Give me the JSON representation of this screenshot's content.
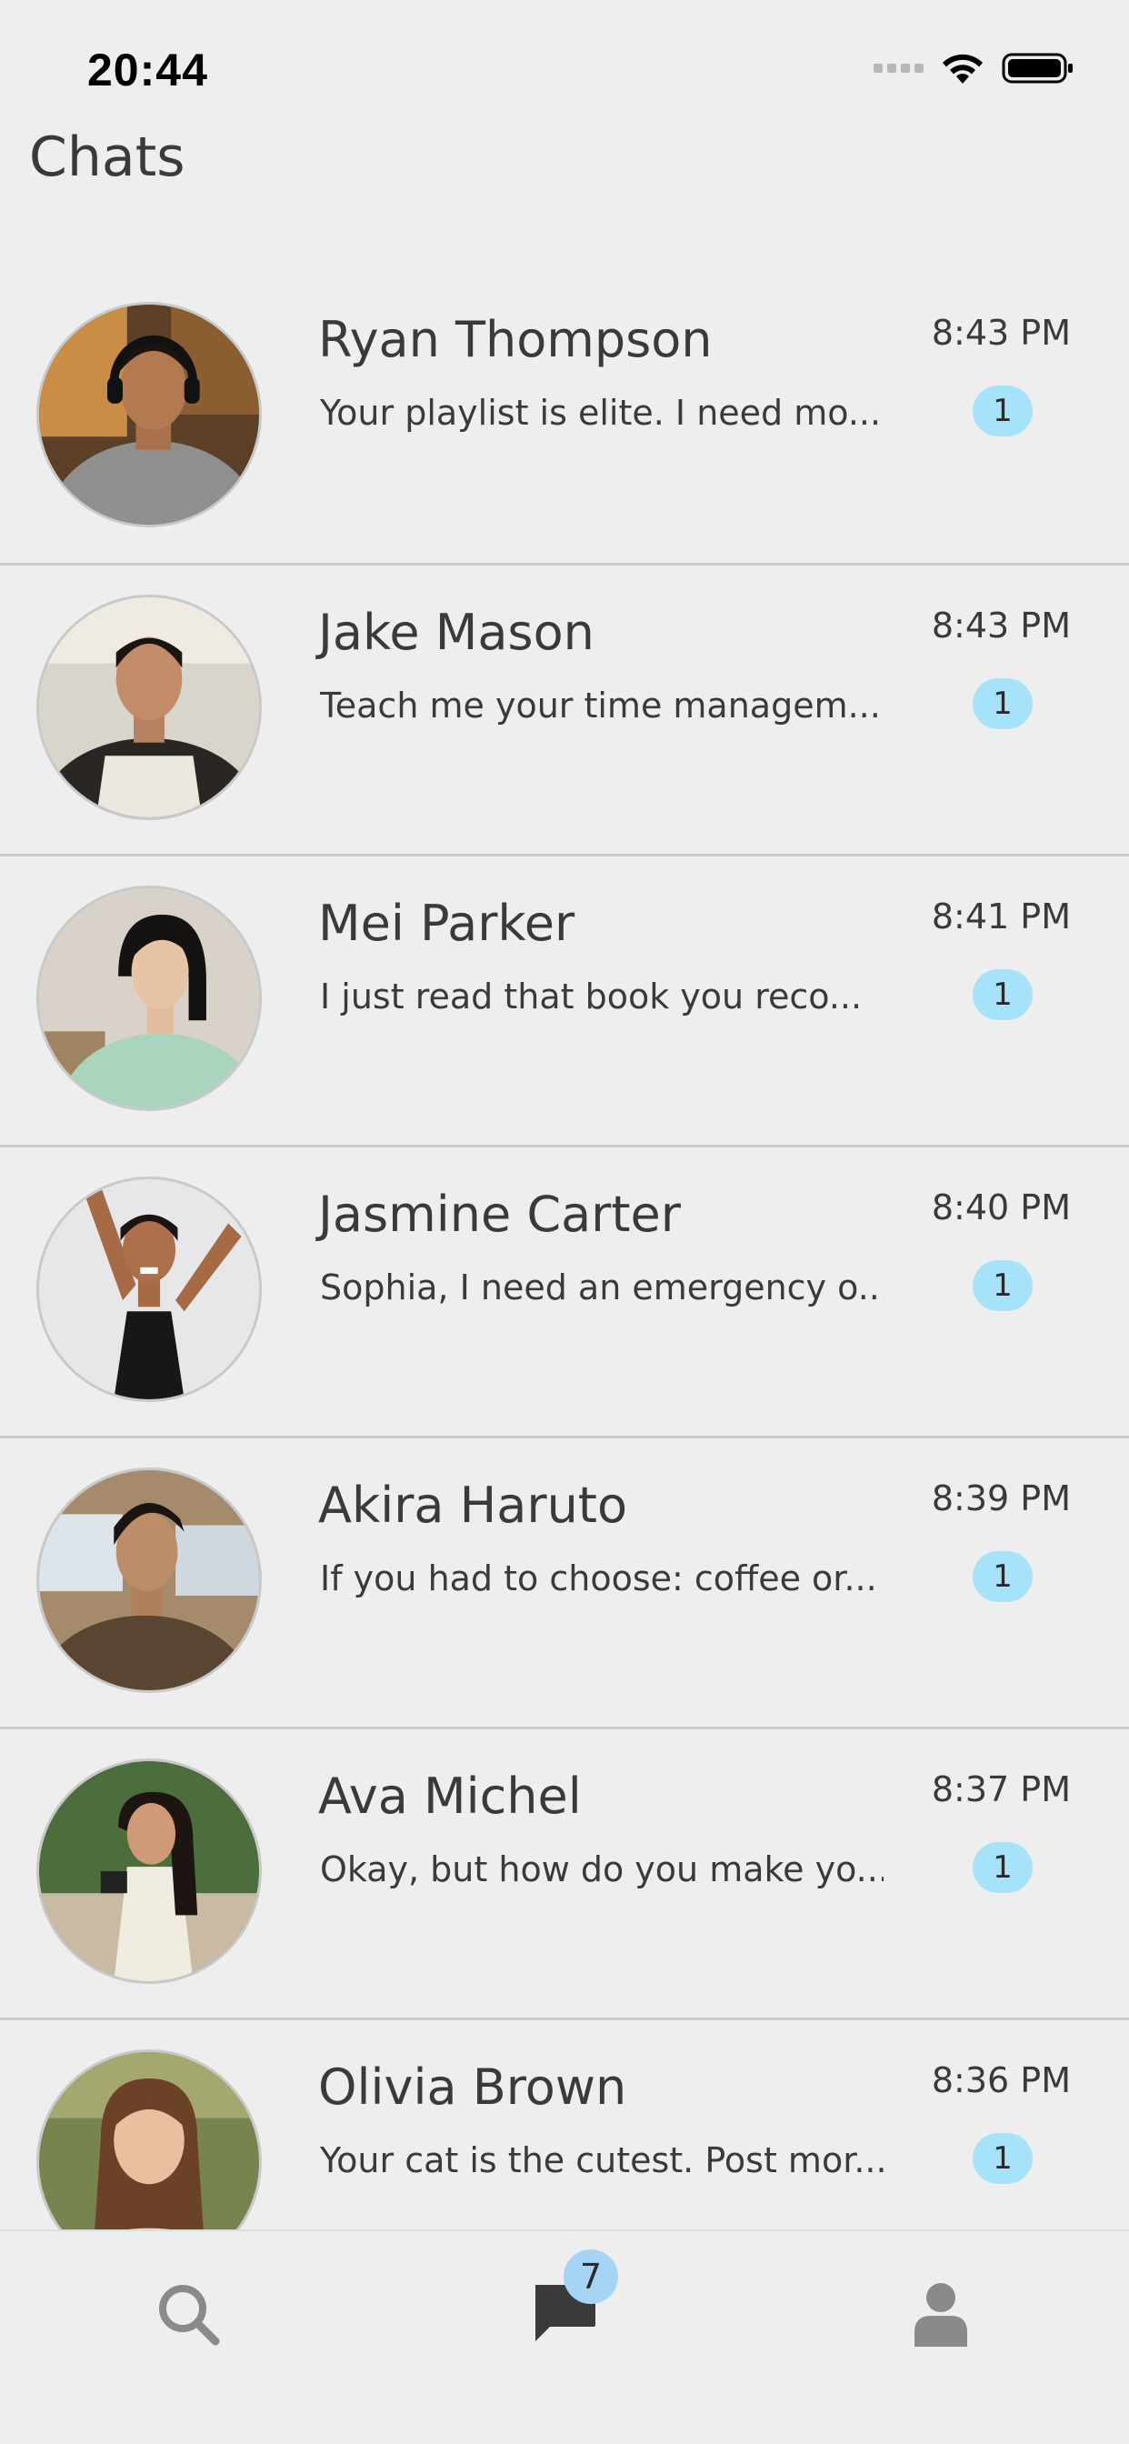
{
  "status_bar": {
    "time": "20:44"
  },
  "header": {
    "title": "Chats"
  },
  "chats": [
    {
      "name": "Ryan Thompson",
      "preview": "Your playlist is elite. I need mo...",
      "time": "8:43 PM",
      "unread": "1"
    },
    {
      "name": "Jake Mason",
      "preview": "Teach me your time managem...",
      "time": "8:43 PM",
      "unread": "1"
    },
    {
      "name": "Mei Parker",
      "preview": "I just read that book you reco...",
      "time": "8:41 PM",
      "unread": "1"
    },
    {
      "name": "Jasmine Carter",
      "preview": "Sophia, I need an emergency o...",
      "time": "8:40 PM",
      "unread": "1"
    },
    {
      "name": "Akira Haruto",
      "preview": "If you had to choose: coffee or...",
      "time": "8:39 PM",
      "unread": "1"
    },
    {
      "name": "Ava Michel",
      "preview": "Okay, but how do you make yo...",
      "time": "8:37 PM",
      "unread": "1"
    },
    {
      "name": "Olivia Brown",
      "preview": "Your cat is the cutest. Post mor...",
      "time": "8:36 PM",
      "unread": "1"
    }
  ],
  "tab_bar": {
    "tabs": [
      {
        "icon": "search-icon"
      },
      {
        "icon": "chat-bubble-icon"
      },
      {
        "icon": "person-icon"
      }
    ],
    "chats_badge": "7"
  },
  "colors": {
    "background": "#eeeeee",
    "unread_badge": "#a6e3fb",
    "tab_badge": "#a6d4f5",
    "text": "#3a3a3a",
    "icon_inactive": "#8a8a8a",
    "icon_active": "#3a3a3a"
  }
}
